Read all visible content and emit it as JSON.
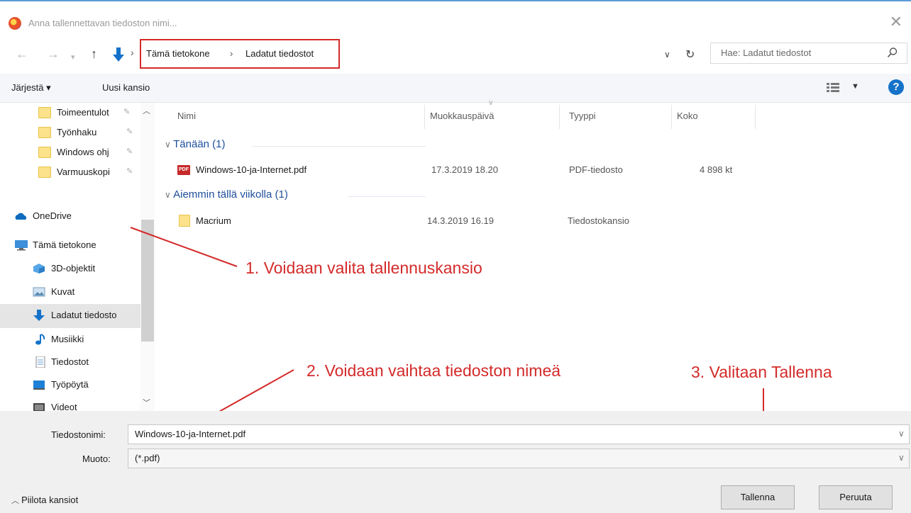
{
  "window": {
    "title": "Anna tallennettavan tiedoston nimi...",
    "close": "✕"
  },
  "address": {
    "separator": "›",
    "crumbs": [
      "Tämä tietokone",
      "Ladatut tiedostot"
    ],
    "search_placeholder": "Hae: Ladatut tiedostot"
  },
  "toolbar": {
    "organize": "Järjestä ▾",
    "new_folder": "Uusi kansio"
  },
  "nav": {
    "items": [
      {
        "label": "Toimeentulot",
        "icon": "folder-icon",
        "pinned": true
      },
      {
        "label": "Työnhaku",
        "icon": "folder-icon",
        "pinned": true
      },
      {
        "label": "Windows ohj",
        "icon": "folder-icon",
        "pinned": true
      },
      {
        "label": "Varmuuskopi",
        "icon": "folder-icon",
        "pinned": true
      },
      {
        "label": "OneDrive",
        "icon": "onedrive-icon"
      },
      {
        "label": "Tämä tietokone",
        "icon": "computer-icon"
      },
      {
        "label": "3D-objektit",
        "icon": "3d-objects-icon"
      },
      {
        "label": "Kuvat",
        "icon": "pictures-icon"
      },
      {
        "label": "Ladatut tiedosto",
        "icon": "download-icon",
        "selected": true
      },
      {
        "label": "Musiikki",
        "icon": "music-icon"
      },
      {
        "label": "Tiedostot",
        "icon": "documents-icon"
      },
      {
        "label": "Työpöytä",
        "icon": "desktop-icon"
      },
      {
        "label": "Videot",
        "icon": "videos-icon"
      }
    ]
  },
  "columns": [
    "Nimi",
    "Muokkauspäivä",
    "Tyyppi",
    "Koko"
  ],
  "groups": [
    {
      "label": "Tänään (1)",
      "files": [
        {
          "name": "Windows-10-ja-Internet.pdf",
          "date": "17.3.2019 18.20",
          "type": "PDF-tiedosto",
          "size": "4 898 kt",
          "icon": "pdf-icon"
        }
      ]
    },
    {
      "label": "Aiemmin tällä viikolla (1)",
      "files": [
        {
          "name": "Macrium",
          "date": "14.3.2019 16.19",
          "type": "Tiedostokansio",
          "size": "",
          "icon": "folder-icon"
        }
      ]
    }
  ],
  "annotations": [
    "1. Voidaan valita tallennuskansio",
    "2. Voidaan vaihtaa tiedoston nimeä",
    "3. Valitaan Tallenna"
  ],
  "form": {
    "filename_label": "Tiedostonimi:",
    "filename_value": "Windows-10-ja-Internet.pdf",
    "type_label": "Muoto:",
    "type_value": "(*.pdf)"
  },
  "footer": {
    "hide_folders": "Piilota kansiot",
    "save": "Tallenna",
    "cancel": "Peruuta"
  },
  "colors": {
    "annotation": "#d42a2a",
    "accent": "#1572c9",
    "group_header": "#1f4e9c"
  }
}
